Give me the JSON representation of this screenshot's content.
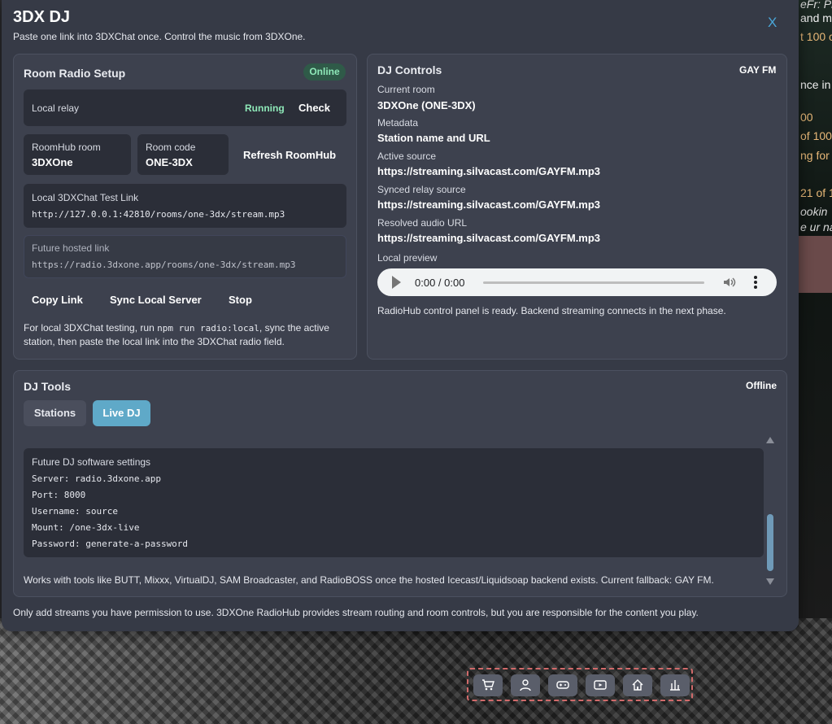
{
  "background": {
    "chat_lines": [
      {
        "text": "eFr: Pl",
        "style": "italic"
      },
      {
        "text": "and m",
        "style": "white"
      },
      {
        "text": "t 100 c",
        "style": "normal"
      },
      {
        "text": "nce in",
        "style": "white"
      },
      {
        "text": "00",
        "style": "normal"
      },
      {
        "text": "of 100",
        "style": "normal"
      },
      {
        "text": "ng for a",
        "style": "normal"
      },
      {
        "text": "21 of 1",
        "style": "normal"
      },
      {
        "text": "ookin",
        "style": "italic"
      },
      {
        "text": "e ur na",
        "style": "italic"
      }
    ]
  },
  "modal": {
    "title": "3DX DJ",
    "subtitle": "Paste one link into 3DXChat once. Control the music from 3DXOne.",
    "close_label": "X"
  },
  "room_setup": {
    "title": "Room Radio Setup",
    "status_badge": "Online",
    "local_relay_label": "Local relay",
    "local_relay_status": "Running",
    "check_label": "Check",
    "roomhub_room_label": "RoomHub room",
    "roomhub_room_value": "3DXOne",
    "room_code_label": "Room code",
    "room_code_value": "ONE-3DX",
    "refresh_label": "Refresh RoomHub",
    "local_link_label": "Local 3DXChat Test Link",
    "local_link_value": "http://127.0.0.1:42810/rooms/one-3dx/stream.mp3",
    "future_link_label": "Future hosted link",
    "future_link_value": "https://radio.3dxone.app/rooms/one-3dx/stream.mp3",
    "copy_label": "Copy Link",
    "sync_label": "Sync Local Server",
    "stop_label": "Stop",
    "help_pre": "For local 3DXChat testing, run ",
    "help_code": "npm run radio:local",
    "help_post": ", sync the active station, then paste the local link into the 3DXChat radio field."
  },
  "dj_controls": {
    "title": "DJ Controls",
    "station_badge": "GAY FM",
    "current_room_label": "Current room",
    "current_room_value": "3DXOne (ONE-3DX)",
    "metadata_label": "Metadata",
    "metadata_value": "Station name and URL",
    "active_source_label": "Active source",
    "active_source_value": "https://streaming.silvacast.com/GAYFM.mp3",
    "synced_relay_label": "Synced relay source",
    "synced_relay_value": "https://streaming.silvacast.com/GAYFM.mp3",
    "resolved_audio_label": "Resolved audio URL",
    "resolved_audio_value": "https://streaming.silvacast.com/GAYFM.mp3",
    "local_preview_label": "Local preview",
    "player_time": "0:00 / 0:00",
    "status_text": "RadioHub control panel is ready. Backend streaming connects in the next phase."
  },
  "dj_tools": {
    "title": "DJ Tools",
    "status": "Offline",
    "tabs": [
      {
        "label": "Stations",
        "active": false
      },
      {
        "label": "Live DJ",
        "active": true
      }
    ],
    "settings_title": "Future DJ software settings",
    "settings_lines": [
      "Server: radio.3dxone.app",
      "Port: 8000",
      "Username: source",
      "Mount: /one-3dx-live",
      "Password: generate-a-password"
    ],
    "footer_text": "Works with tools like BUTT, Mixxx, VirtualDJ, SAM Broadcaster, and RadioBOSS once the hosted Icecast/Liquidsoap backend exists. Current fallback: GAY FM."
  },
  "disclaimer": "Only add streams you have permission to use. 3DXOne RadioHub provides stream routing and room controls, but you are responsible for the content you play.",
  "toolbar": {
    "icons": [
      "cart-icon",
      "user-icon",
      "gamepad-icon",
      "play-screen-icon",
      "home-icon",
      "chart-icon"
    ]
  },
  "colors": {
    "accent": "#5fa9c8",
    "online": "#8ee8b8",
    "close": "#4aa6d8"
  }
}
